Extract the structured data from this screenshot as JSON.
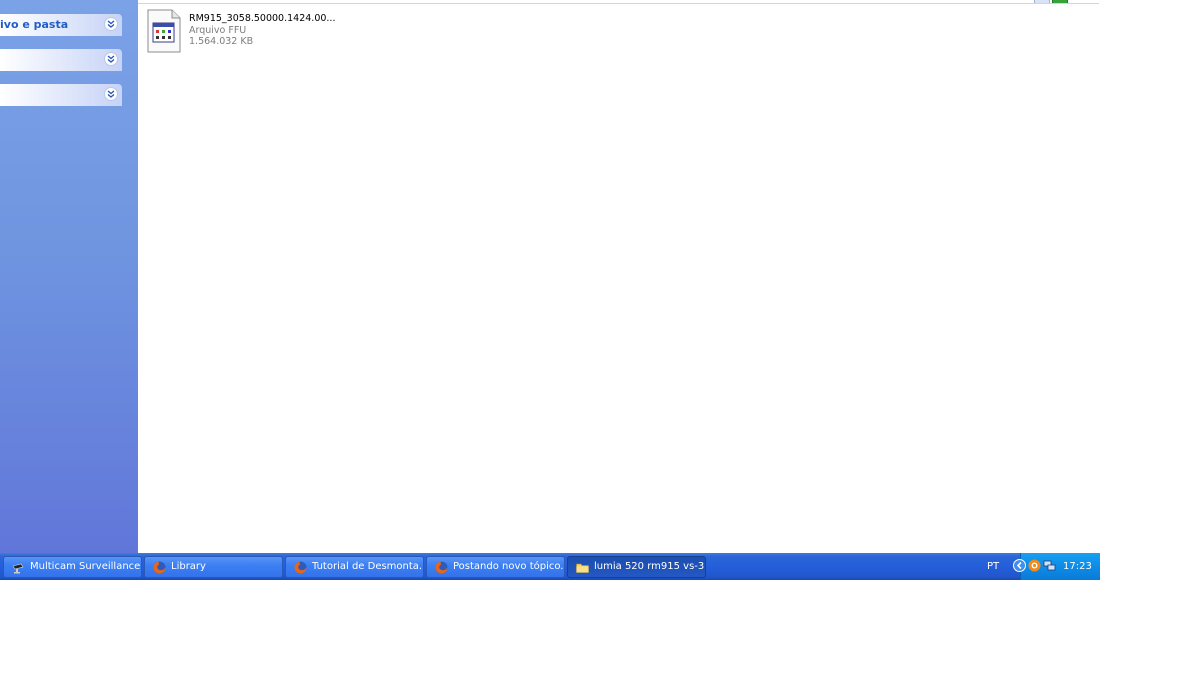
{
  "task_pane": {
    "sections": [
      {
        "title": "ivo e pasta"
      },
      {
        "title": ""
      },
      {
        "title": ""
      }
    ]
  },
  "file": {
    "name": "RM915_3058.50000.1424.00...",
    "type": "Arquivo FFU",
    "size": "1.564.032 KB"
  },
  "taskbar": {
    "buttons": [
      {
        "label": "Multicam Surveillance ...",
        "icon": "camera-icon"
      },
      {
        "label": "Library",
        "icon": "firefox-icon"
      },
      {
        "label": "Tutorial de Desmonta...",
        "icon": "firefox-icon"
      },
      {
        "label": "Postando novo tópico...",
        "icon": "firefox-icon"
      },
      {
        "label": "lumia 520 rm915 vs-3...",
        "icon": "folder-icon"
      }
    ],
    "language": "PT",
    "clock": "17:23"
  },
  "colors": {
    "taskbar": "#245edb",
    "tray": "#0e8ce6",
    "pane_top": "#7ba2e7",
    "pane_bottom": "#6176d9",
    "pane_header_text": "#215dc6"
  }
}
